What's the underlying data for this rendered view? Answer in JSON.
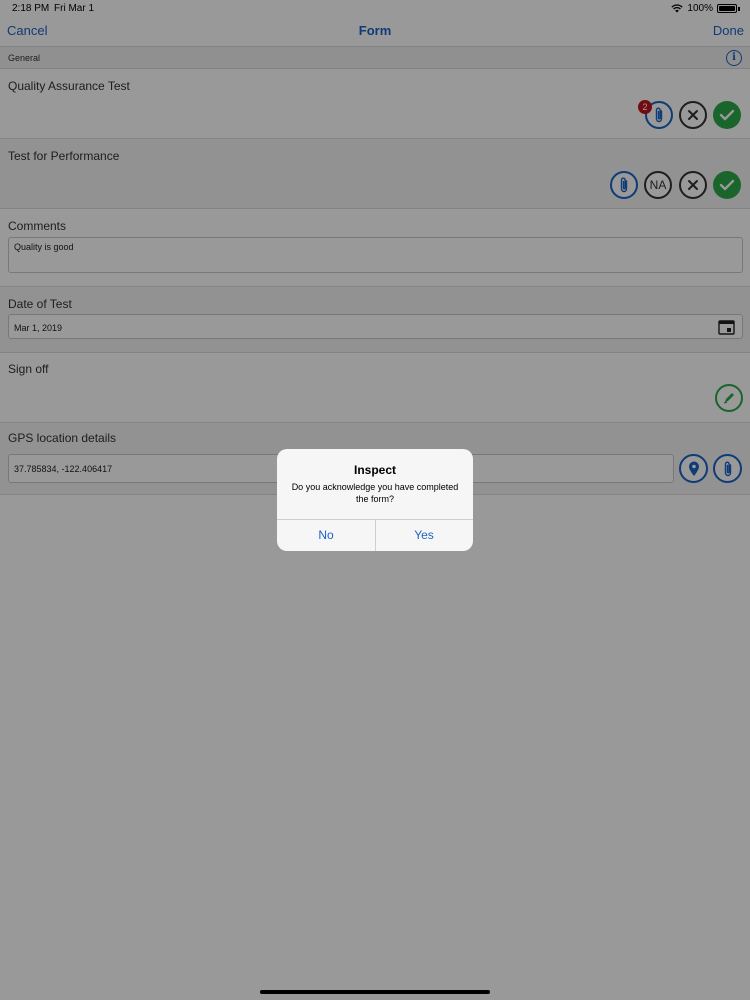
{
  "status_bar": {
    "time": "2:18 PM",
    "date": "Fri Mar 1",
    "battery": "100%"
  },
  "nav": {
    "cancel": "Cancel",
    "title": "Form",
    "done": "Done"
  },
  "section": {
    "label": "General"
  },
  "rows": {
    "qa": {
      "title": "Quality Assurance Test",
      "attachment_count": "2"
    },
    "perf": {
      "title": "Test for Performance",
      "na_label": "NA"
    },
    "comments": {
      "title": "Comments",
      "value": "Quality is good"
    },
    "date": {
      "title": "Date of Test",
      "value": "Mar 1, 2019"
    },
    "signoff": {
      "title": "Sign off"
    },
    "gps": {
      "title": "GPS location details",
      "value": "37.785834, -122.406417"
    }
  },
  "dialog": {
    "title": "Inspect",
    "message": "Do you acknowledge you have completed the form?",
    "no": "No",
    "yes": "Yes"
  },
  "colors": {
    "accent": "#1a63c6",
    "success": "#2aa84a",
    "badge": "#c0141e"
  }
}
